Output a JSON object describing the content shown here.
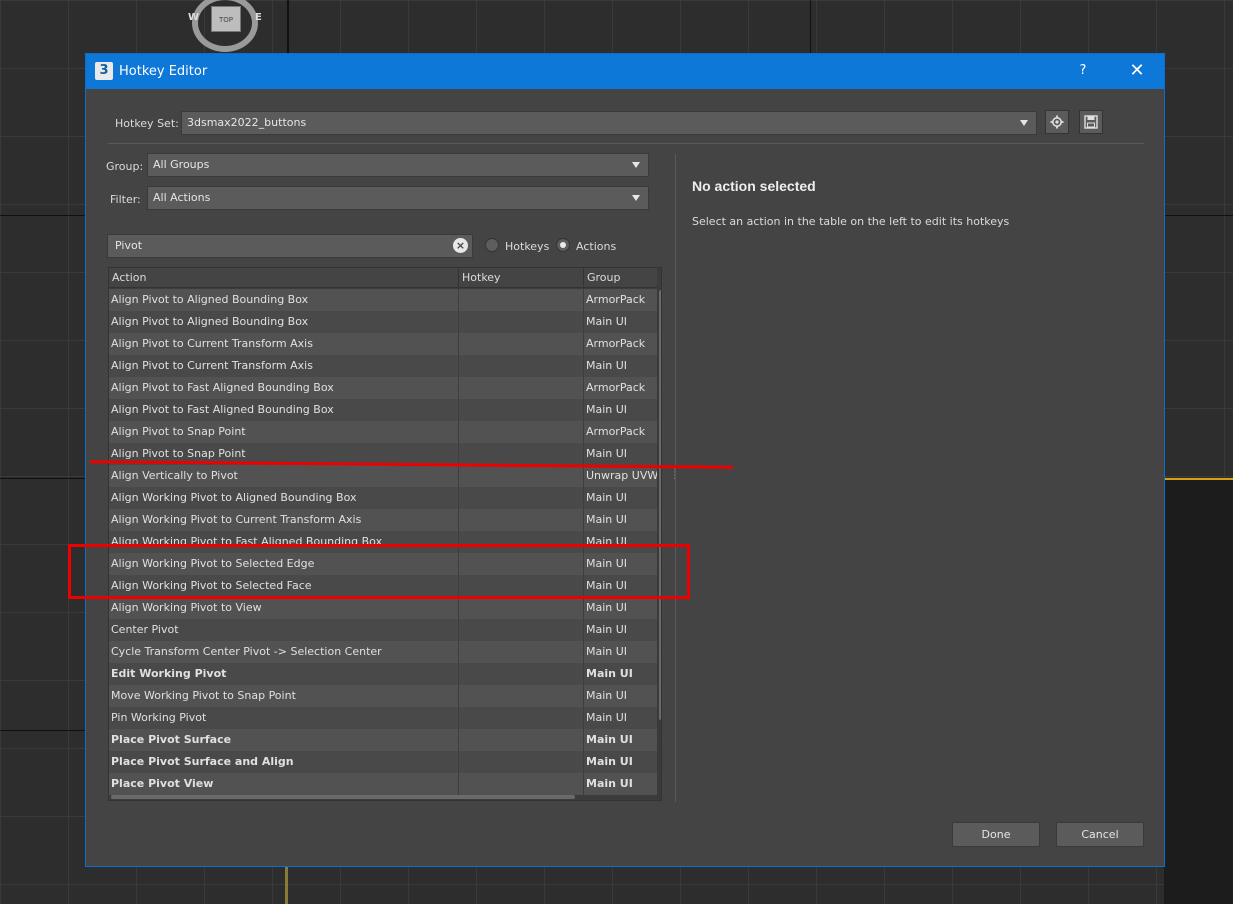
{
  "dialog": {
    "title": "Hotkey Editor",
    "app_icon_text": "3",
    "help_label": "?",
    "close_label": "✕"
  },
  "hotkey_set": {
    "label": "Hotkey Set:",
    "value": "3dsmax2022_buttons"
  },
  "group": {
    "label": "Group:",
    "value": "All Groups"
  },
  "filter": {
    "label": "Filter:",
    "value": "All Actions"
  },
  "search": {
    "value": "Pivot"
  },
  "radio": {
    "hotkeys_label": "Hotkeys",
    "actions_label": "Actions",
    "selected": "Actions"
  },
  "table": {
    "columns": [
      "Action",
      "Hotkey",
      "Group"
    ],
    "rows": [
      {
        "action": "Align Pivot to Aligned Bounding Box",
        "hotkey": "",
        "group": "ArmorPack",
        "bold": false
      },
      {
        "action": "Align Pivot to Aligned Bounding Box",
        "hotkey": "",
        "group": "Main UI",
        "bold": false
      },
      {
        "action": "Align Pivot to Current Transform Axis",
        "hotkey": "",
        "group": "ArmorPack",
        "bold": false
      },
      {
        "action": "Align Pivot to Current Transform Axis",
        "hotkey": "",
        "group": "Main UI",
        "bold": false
      },
      {
        "action": "Align Pivot to Fast Aligned Bounding Box",
        "hotkey": "",
        "group": "ArmorPack",
        "bold": false
      },
      {
        "action": "Align Pivot to Fast Aligned Bounding Box",
        "hotkey": "",
        "group": "Main UI",
        "bold": false
      },
      {
        "action": "Align Pivot to Snap Point",
        "hotkey": "",
        "group": "ArmorPack",
        "bold": false
      },
      {
        "action": "Align Pivot to Snap Point",
        "hotkey": "",
        "group": "Main UI",
        "bold": false
      },
      {
        "action": "Align Vertically to Pivot",
        "hotkey": "",
        "group": "Unwrap UVW",
        "bold": false
      },
      {
        "action": "Align Working Pivot to Aligned Bounding Box",
        "hotkey": "",
        "group": "Main UI",
        "bold": false
      },
      {
        "action": "Align Working Pivot to Current Transform Axis",
        "hotkey": "",
        "group": "Main UI",
        "bold": false
      },
      {
        "action": "Align Working Pivot to Fast Aligned Bounding Box",
        "hotkey": "",
        "group": "Main UI",
        "bold": false
      },
      {
        "action": "Align Working Pivot to Selected Edge",
        "hotkey": "",
        "group": "Main UI",
        "bold": false
      },
      {
        "action": "Align Working Pivot to Selected Face",
        "hotkey": "",
        "group": "Main UI",
        "bold": false
      },
      {
        "action": "Align Working Pivot to View",
        "hotkey": "",
        "group": "Main UI",
        "bold": false
      },
      {
        "action": "Center Pivot",
        "hotkey": "",
        "group": "Main UI",
        "bold": false
      },
      {
        "action": "Cycle Transform Center Pivot -> Selection Center",
        "hotkey": "",
        "group": "Main UI",
        "bold": false
      },
      {
        "action": "Edit Working Pivot",
        "hotkey": "",
        "group": "Main UI",
        "bold": true
      },
      {
        "action": "Move Working Pivot to Snap Point",
        "hotkey": "",
        "group": "Main UI",
        "bold": false
      },
      {
        "action": "Pin Working Pivot",
        "hotkey": "",
        "group": "Main UI",
        "bold": false
      },
      {
        "action": "Place Pivot Surface",
        "hotkey": "",
        "group": "Main UI",
        "bold": true
      },
      {
        "action": "Place Pivot Surface and Align",
        "hotkey": "",
        "group": "Main UI",
        "bold": true
      },
      {
        "action": "Place Pivot View",
        "hotkey": "",
        "group": "Main UI",
        "bold": true
      }
    ]
  },
  "detail": {
    "heading": "No action selected",
    "hint": "Select an action in the table on the left to edit its hotkeys"
  },
  "buttons": {
    "done": "Done",
    "cancel": "Cancel"
  },
  "icons": {
    "settings": "gear-icon",
    "save": "floppy-disk-icon"
  },
  "gizmo": {
    "cube_label": "TOP",
    "west": "W",
    "east": "E"
  },
  "colors": {
    "titlebar": "#0d78d8",
    "annotation": "#e00000"
  }
}
